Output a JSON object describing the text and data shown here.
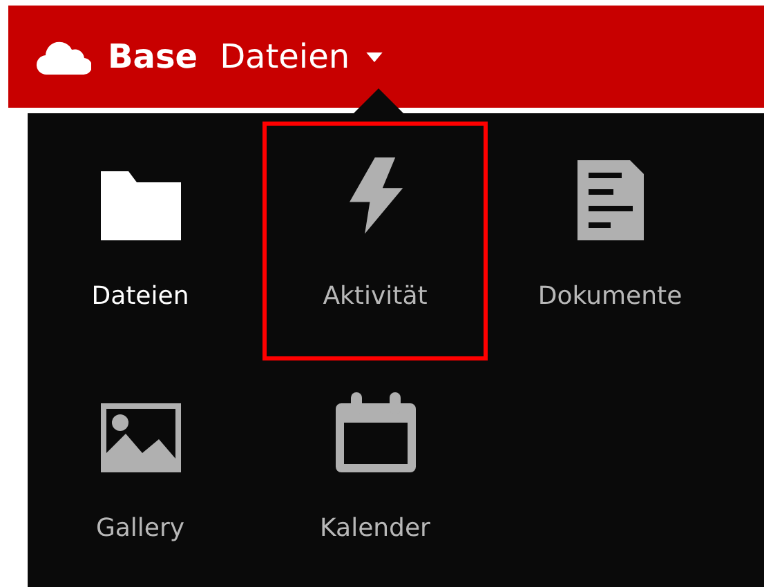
{
  "header": {
    "brand": "Base",
    "app_menu": "Dateien"
  },
  "apps": [
    {
      "kind": "folder",
      "label": "Dateien",
      "current": true,
      "selected": false
    },
    {
      "kind": "activity",
      "label": "Aktivität",
      "current": false,
      "selected": true
    },
    {
      "kind": "document",
      "label": "Dokumente",
      "current": false,
      "selected": false
    },
    {
      "kind": "gallery",
      "label": "Gallery",
      "current": false,
      "selected": false
    },
    {
      "kind": "calendar",
      "label": "Kalender",
      "current": false,
      "selected": false
    }
  ]
}
